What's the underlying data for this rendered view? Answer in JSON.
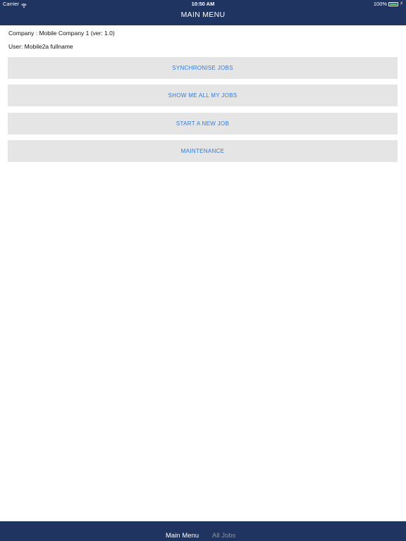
{
  "status_bar": {
    "carrier": "Carrier",
    "time": "10:50 AM",
    "battery": "100%",
    "icons": [
      "wifi-icon",
      "battery-icon",
      "charging-bolt-icon"
    ]
  },
  "nav": {
    "title": "MAIN MENU"
  },
  "info": {
    "company": "Company : Mobile Company 1 (ver: 1.0)",
    "user": "User: Mobile2a fullname"
  },
  "buttons": {
    "synchronise": "SYNCHRONISE JOBS",
    "show_all": "SHOW ME ALL MY JOBS",
    "start_new": "START A NEW JOB",
    "maintenance": "MAINTENANCE"
  },
  "tabs": [
    {
      "label": "Main Menu",
      "selected": true
    },
    {
      "label": "All Jobs",
      "selected": false
    }
  ],
  "colors": {
    "nav_background": "#203462",
    "button_background": "#e5e5e5",
    "button_text": "#2e7be0",
    "battery_fill": "#4cd964",
    "inactive_tab": "#8a93a8"
  }
}
